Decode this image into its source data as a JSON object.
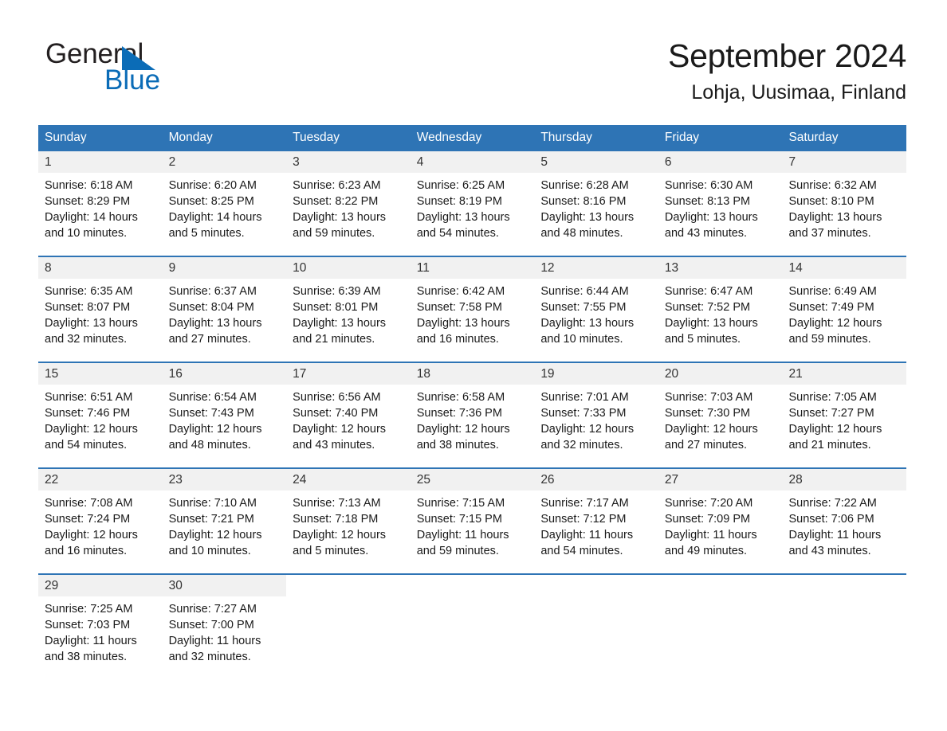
{
  "brand": {
    "name_part1": "General",
    "name_part2": "Blue",
    "logo_icon": "triangle-icon",
    "accent_color": "#0b6cb7"
  },
  "header": {
    "title": "September 2024",
    "subtitle": "Lohja, Uusimaa, Finland"
  },
  "theme": {
    "header_blue": "#2e74b5",
    "day_band_gray": "#f1f1f1",
    "text_color": "#1a1a1a"
  },
  "weekdays": [
    "Sunday",
    "Monday",
    "Tuesday",
    "Wednesday",
    "Thursday",
    "Friday",
    "Saturday"
  ],
  "weeks": [
    [
      {
        "day": "1",
        "sunrise": "Sunrise: 6:18 AM",
        "sunset": "Sunset: 8:29 PM",
        "daylight": "Daylight: 14 hours and 10 minutes."
      },
      {
        "day": "2",
        "sunrise": "Sunrise: 6:20 AM",
        "sunset": "Sunset: 8:25 PM",
        "daylight": "Daylight: 14 hours and 5 minutes."
      },
      {
        "day": "3",
        "sunrise": "Sunrise: 6:23 AM",
        "sunset": "Sunset: 8:22 PM",
        "daylight": "Daylight: 13 hours and 59 minutes."
      },
      {
        "day": "4",
        "sunrise": "Sunrise: 6:25 AM",
        "sunset": "Sunset: 8:19 PM",
        "daylight": "Daylight: 13 hours and 54 minutes."
      },
      {
        "day": "5",
        "sunrise": "Sunrise: 6:28 AM",
        "sunset": "Sunset: 8:16 PM",
        "daylight": "Daylight: 13 hours and 48 minutes."
      },
      {
        "day": "6",
        "sunrise": "Sunrise: 6:30 AM",
        "sunset": "Sunset: 8:13 PM",
        "daylight": "Daylight: 13 hours and 43 minutes."
      },
      {
        "day": "7",
        "sunrise": "Sunrise: 6:32 AM",
        "sunset": "Sunset: 8:10 PM",
        "daylight": "Daylight: 13 hours and 37 minutes."
      }
    ],
    [
      {
        "day": "8",
        "sunrise": "Sunrise: 6:35 AM",
        "sunset": "Sunset: 8:07 PM",
        "daylight": "Daylight: 13 hours and 32 minutes."
      },
      {
        "day": "9",
        "sunrise": "Sunrise: 6:37 AM",
        "sunset": "Sunset: 8:04 PM",
        "daylight": "Daylight: 13 hours and 27 minutes."
      },
      {
        "day": "10",
        "sunrise": "Sunrise: 6:39 AM",
        "sunset": "Sunset: 8:01 PM",
        "daylight": "Daylight: 13 hours and 21 minutes."
      },
      {
        "day": "11",
        "sunrise": "Sunrise: 6:42 AM",
        "sunset": "Sunset: 7:58 PM",
        "daylight": "Daylight: 13 hours and 16 minutes."
      },
      {
        "day": "12",
        "sunrise": "Sunrise: 6:44 AM",
        "sunset": "Sunset: 7:55 PM",
        "daylight": "Daylight: 13 hours and 10 minutes."
      },
      {
        "day": "13",
        "sunrise": "Sunrise: 6:47 AM",
        "sunset": "Sunset: 7:52 PM",
        "daylight": "Daylight: 13 hours and 5 minutes."
      },
      {
        "day": "14",
        "sunrise": "Sunrise: 6:49 AM",
        "sunset": "Sunset: 7:49 PM",
        "daylight": "Daylight: 12 hours and 59 minutes."
      }
    ],
    [
      {
        "day": "15",
        "sunrise": "Sunrise: 6:51 AM",
        "sunset": "Sunset: 7:46 PM",
        "daylight": "Daylight: 12 hours and 54 minutes."
      },
      {
        "day": "16",
        "sunrise": "Sunrise: 6:54 AM",
        "sunset": "Sunset: 7:43 PM",
        "daylight": "Daylight: 12 hours and 48 minutes."
      },
      {
        "day": "17",
        "sunrise": "Sunrise: 6:56 AM",
        "sunset": "Sunset: 7:40 PM",
        "daylight": "Daylight: 12 hours and 43 minutes."
      },
      {
        "day": "18",
        "sunrise": "Sunrise: 6:58 AM",
        "sunset": "Sunset: 7:36 PM",
        "daylight": "Daylight: 12 hours and 38 minutes."
      },
      {
        "day": "19",
        "sunrise": "Sunrise: 7:01 AM",
        "sunset": "Sunset: 7:33 PM",
        "daylight": "Daylight: 12 hours and 32 minutes."
      },
      {
        "day": "20",
        "sunrise": "Sunrise: 7:03 AM",
        "sunset": "Sunset: 7:30 PM",
        "daylight": "Daylight: 12 hours and 27 minutes."
      },
      {
        "day": "21",
        "sunrise": "Sunrise: 7:05 AM",
        "sunset": "Sunset: 7:27 PM",
        "daylight": "Daylight: 12 hours and 21 minutes."
      }
    ],
    [
      {
        "day": "22",
        "sunrise": "Sunrise: 7:08 AM",
        "sunset": "Sunset: 7:24 PM",
        "daylight": "Daylight: 12 hours and 16 minutes."
      },
      {
        "day": "23",
        "sunrise": "Sunrise: 7:10 AM",
        "sunset": "Sunset: 7:21 PM",
        "daylight": "Daylight: 12 hours and 10 minutes."
      },
      {
        "day": "24",
        "sunrise": "Sunrise: 7:13 AM",
        "sunset": "Sunset: 7:18 PM",
        "daylight": "Daylight: 12 hours and 5 minutes."
      },
      {
        "day": "25",
        "sunrise": "Sunrise: 7:15 AM",
        "sunset": "Sunset: 7:15 PM",
        "daylight": "Daylight: 11 hours and 59 minutes."
      },
      {
        "day": "26",
        "sunrise": "Sunrise: 7:17 AM",
        "sunset": "Sunset: 7:12 PM",
        "daylight": "Daylight: 11 hours and 54 minutes."
      },
      {
        "day": "27",
        "sunrise": "Sunrise: 7:20 AM",
        "sunset": "Sunset: 7:09 PM",
        "daylight": "Daylight: 11 hours and 49 minutes."
      },
      {
        "day": "28",
        "sunrise": "Sunrise: 7:22 AM",
        "sunset": "Sunset: 7:06 PM",
        "daylight": "Daylight: 11 hours and 43 minutes."
      }
    ],
    [
      {
        "day": "29",
        "sunrise": "Sunrise: 7:25 AM",
        "sunset": "Sunset: 7:03 PM",
        "daylight": "Daylight: 11 hours and 38 minutes."
      },
      {
        "day": "30",
        "sunrise": "Sunrise: 7:27 AM",
        "sunset": "Sunset: 7:00 PM",
        "daylight": "Daylight: 11 hours and 32 minutes."
      },
      {
        "day": "",
        "sunrise": "",
        "sunset": "",
        "daylight": ""
      },
      {
        "day": "",
        "sunrise": "",
        "sunset": "",
        "daylight": ""
      },
      {
        "day": "",
        "sunrise": "",
        "sunset": "",
        "daylight": ""
      },
      {
        "day": "",
        "sunrise": "",
        "sunset": "",
        "daylight": ""
      },
      {
        "day": "",
        "sunrise": "",
        "sunset": "",
        "daylight": ""
      }
    ]
  ]
}
